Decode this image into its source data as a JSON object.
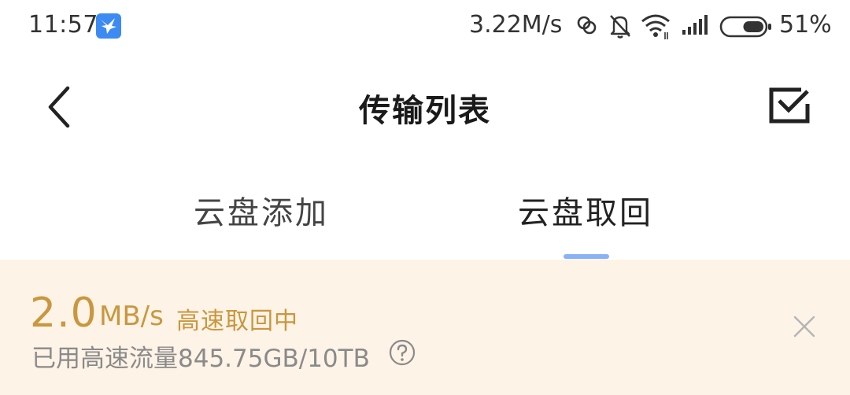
{
  "status_bar": {
    "time": "11:57",
    "app_icon": "bird-icon",
    "network_speed": "3.22M/s",
    "icons": [
      "hotspot-icon",
      "mute-bell-icon",
      "wifi-icon",
      "signal-icon",
      "battery-icon"
    ],
    "battery_level": 0.51,
    "battery_percent": "51%"
  },
  "header": {
    "back_icon": "chevron-left-icon",
    "title": "传输列表",
    "select_icon": "checkbox-icon"
  },
  "tabs": [
    {
      "label": "云盘添加",
      "active": false
    },
    {
      "label": "云盘取回",
      "active": true
    }
  ],
  "speed_banner": {
    "speed_value": "2.0",
    "speed_unit": "MB/s",
    "status": "高速取回中",
    "usage": "已用高速流量845.75GB/10TB",
    "help_icon": "question-circle-icon",
    "close_icon": "close-icon"
  },
  "colors": {
    "accent_gold": "#c9973f",
    "banner_bg": "#fdf3e6",
    "tab_indicator": "#8ab2f6",
    "app_icon_blue": "#3d8bf2"
  }
}
